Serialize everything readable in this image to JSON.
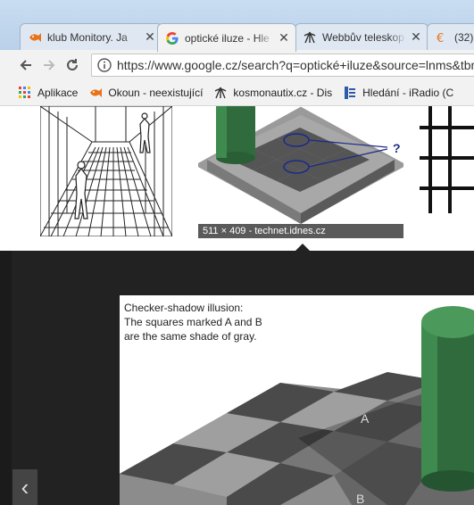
{
  "browser": {
    "tabs": [
      {
        "title": "klub Monitory. Ja",
        "icon": "fish-icon",
        "active": false
      },
      {
        "title": "optické iluze - Hle",
        "icon": "google-icon",
        "active": true
      },
      {
        "title": "Webbův teleskop",
        "icon": "telescope-icon",
        "active": false
      },
      {
        "title": "(32)",
        "icon": "euro-icon",
        "active": false
      }
    ],
    "address_bar": {
      "url": "https://www.google.cz/search?q=optické+iluze&source=lnms&tbm"
    },
    "bookmarks": [
      {
        "label": "Aplikace",
        "icon": "apps-grid-icon"
      },
      {
        "label": "Okoun - neexistující",
        "icon": "fish-icon"
      },
      {
        "label": "kosmonautix.cz - Dis",
        "icon": "telescope-icon"
      },
      {
        "label": "Hledání - iRadio (C",
        "icon": "radio-icon"
      }
    ]
  },
  "image_results": {
    "selected_caption": "511 × 409 - technet.idnes.cz",
    "checker_label": "?"
  },
  "preview": {
    "illusion_text_line1": "Checker-shadow illusion:",
    "illusion_text_line2": "The squares marked A and B",
    "illusion_text_line3": "are the same shade of gray.",
    "square_a": "A",
    "square_b": "B",
    "nav_prev_symbol": "‹"
  },
  "colors": {
    "accent_google_blue": "#4285f4",
    "preview_background": "#222222",
    "cylinder_green": "#2f6b3c",
    "caption_bg": "#5a5a5a"
  }
}
